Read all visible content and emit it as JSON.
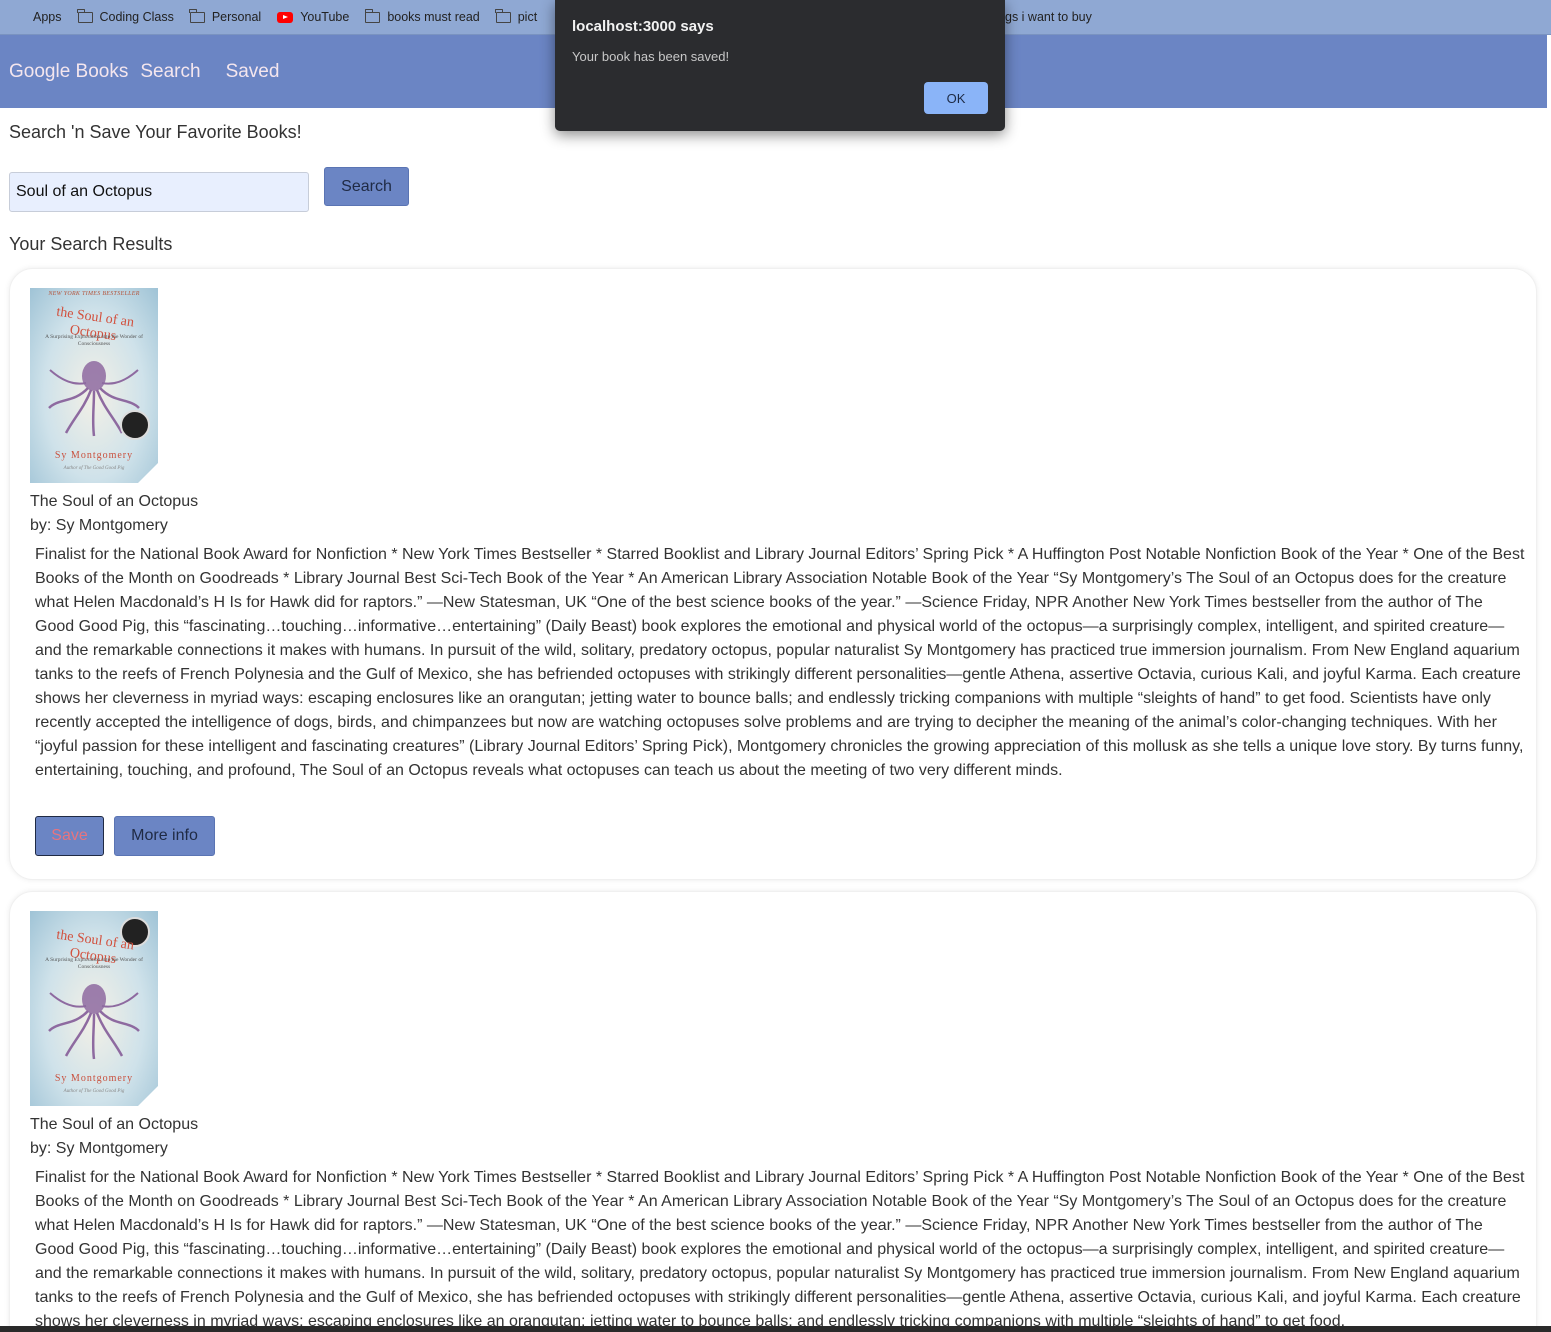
{
  "bookmarks": [
    {
      "label": "Apps",
      "icon": "apps-icon"
    },
    {
      "label": "Coding Class",
      "icon": "folder-icon"
    },
    {
      "label": "Personal",
      "icon": "folder-icon"
    },
    {
      "label": "YouTube",
      "icon": "youtube-icon"
    },
    {
      "label": "books must read",
      "icon": "folder-icon"
    },
    {
      "label": "pict",
      "icon": "folder-icon"
    },
    {
      "label": "gs i want to buy",
      "icon": "folder-icon"
    }
  ],
  "navbar": {
    "brand": "Google Books",
    "links": [
      "Search",
      "Saved"
    ]
  },
  "main": {
    "tagline": "Search 'n Save Your Favorite Books!",
    "search_value": "Soul of an Octopus",
    "search_button": "Search",
    "results_title": "Your Search Results"
  },
  "results": [
    {
      "title": "The Soul of an Octopus",
      "author": "by: Sy Montgomery",
      "description": "Finalist for the National Book Award for Nonfiction * New York Times Bestseller * Starred Booklist and Library Journal Editors’ Spring Pick * A Huffington Post Notable Nonfiction Book of the Year * One of the Best Books of the Month on Goodreads * Library Journal Best Sci-Tech Book of the Year * An American Library Association Notable Book of the Year “Sy Montgomery’s The Soul of an Octopus does for the creature what Helen Macdonald’s H Is for Hawk did for raptors.” —New Statesman, UK “One of the best science books of the year.” —Science Friday, NPR Another New York Times bestseller from the author of The Good Good Pig, this “fascinating…touching…informative…entertaining” (Daily Beast) book explores the emotional and physical world of the octopus—a surprisingly complex, intelligent, and spirited creature—and the remarkable connections it makes with humans. In pursuit of the wild, solitary, predatory octopus, popular naturalist Sy Montgomery has practiced true immersion journalism. From New England aquarium tanks to the reefs of French Polynesia and the Gulf of Mexico, she has befriended octopuses with strikingly different personalities—gentle Athena, assertive Octavia, curious Kali, and joyful Karma. Each creature shows her cleverness in myriad ways: escaping enclosures like an orangutan; jetting water to bounce balls; and endlessly tricking companions with multiple “sleights of hand” to get food. Scientists have only recently accepted the intelligence of dogs, birds, and chimpanzees but now are watching octopuses solve problems and are trying to decipher the meaning of the animal’s color-changing techniques. With her “joyful passion for these intelligent and fascinating creatures” (Library Journal Editors’ Spring Pick), Montgomery chronicles the growing appreciation of this mollusk as she tells a unique love story. By turns funny, entertaining, touching, and profound, The Soul of an Octopus reveals what octopuses can teach us about the meeting of two very different minds.",
      "save_label": "Save",
      "more_label": "More info",
      "cover": {
        "banner": "NEW YORK TIMES BESTSELLER",
        "title": "the Soul of an Octopus",
        "subtitle": "A Surprising Exploration into the Wonder of Consciousness",
        "author": "Sy Montgomery",
        "note": "Author of The Good Good Pig"
      }
    },
    {
      "title": "The Soul of an Octopus",
      "author": "by: Sy Montgomery",
      "description": "Finalist for the National Book Award for Nonfiction * New York Times Bestseller * Starred Booklist and Library Journal Editors’ Spring Pick * A Huffington Post Notable Nonfiction Book of the Year * One of the Best Books of the Month on Goodreads * Library Journal Best Sci-Tech Book of the Year * An American Library Association Notable Book of the Year “Sy Montgomery’s The Soul of an Octopus does for the creature what Helen Macdonald’s H Is for Hawk did for raptors.” —New Statesman, UK “One of the best science books of the year.” —Science Friday, NPR Another New York Times bestseller from the author of The Good Good Pig, this “fascinating…touching…informative…entertaining” (Daily Beast) book explores the emotional and physical world of the octopus—a surprisingly complex, intelligent, and spirited creature—and the remarkable connections it makes with humans. In pursuit of the wild, solitary, predatory octopus, popular naturalist Sy Montgomery has practiced true immersion journalism. From New England aquarium tanks to the reefs of French Polynesia and the Gulf of Mexico, she has befriended octopuses with strikingly different personalities—gentle Athena, assertive Octavia, curious Kali, and joyful Karma. Each creature shows her cleverness in myriad ways: escaping enclosures like an orangutan; jetting water to bounce balls; and endlessly tricking companions with multiple “sleights of hand” to get food.",
      "cover": {
        "title": "the Soul of an Octopus",
        "subtitle": "A Surprising Exploration into the Wonder of Consciousness",
        "author": "Sy Montgomery",
        "note": "Author of The Good Good Pig"
      }
    }
  ],
  "dialog": {
    "title": "localhost:3000 says",
    "message": "Your book has been saved!",
    "ok_label": "OK"
  },
  "colors": {
    "navbar": "#6b85c4",
    "bookmarks_bar": "#8fa8d3",
    "nav_text": "#f4e6ee",
    "save_text": "#e7747f",
    "dialog_bg": "#2b2c2f",
    "dialog_ok": "#8ab4f8"
  }
}
